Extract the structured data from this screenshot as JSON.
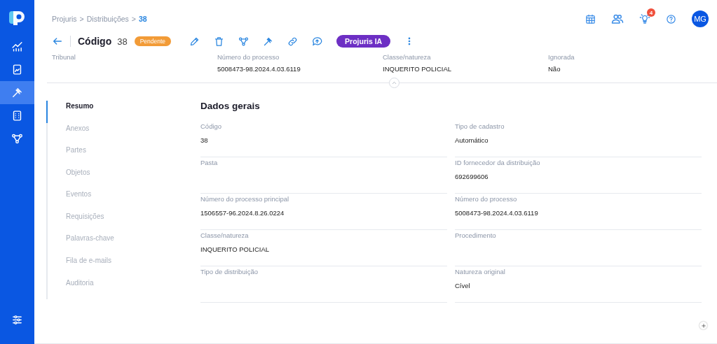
{
  "sidebar": {
    "items": [
      {
        "kind": "chart",
        "selected": false
      },
      {
        "kind": "document",
        "selected": false
      },
      {
        "kind": "gavel",
        "selected": true
      },
      {
        "kind": "calculator",
        "selected": false
      },
      {
        "kind": "workflow",
        "selected": false
      }
    ]
  },
  "breadcrumb": {
    "separator": ">",
    "items": [
      "Projuris",
      "Distribuições",
      "38"
    ]
  },
  "top_actions": {
    "notification_count": "4",
    "avatar": "MG"
  },
  "header": {
    "title": "Código",
    "code": "38",
    "status": "Pendente",
    "toolbar": [
      {
        "kind": "edit"
      },
      {
        "kind": "delete"
      },
      {
        "kind": "workflow"
      },
      {
        "kind": "gavel"
      },
      {
        "kind": "link"
      },
      {
        "kind": "comment"
      }
    ],
    "ai_button": "Projuris IA"
  },
  "summary": [
    {
      "label": "Tribunal"
    },
    {
      "label": "Número do processo",
      "value": "5008473-98.2024.4.03.6119"
    },
    {
      "label": "Classe/natureza",
      "value": "INQUERITO POLICIAL"
    },
    {
      "label": "Ignorada",
      "value": "Não"
    }
  ],
  "sections": [
    {
      "label": "Resumo",
      "selected": true
    },
    {
      "label": "Anexos",
      "selected": false
    },
    {
      "label": "Partes",
      "selected": false
    },
    {
      "label": "Objetos",
      "selected": false
    },
    {
      "label": "Eventos",
      "selected": false
    },
    {
      "label": "Requisições",
      "selected": false
    },
    {
      "label": "Palavras-chave",
      "selected": false
    },
    {
      "label": "Fila de e-mails",
      "selected": false
    },
    {
      "label": "Auditoria",
      "selected": false
    }
  ],
  "form": {
    "title": "Dados gerais",
    "fields": [
      {
        "label": "Código",
        "value": "38"
      },
      {
        "label": "Tipo de cadastro",
        "value": "Automático"
      },
      {
        "label": "Pasta"
      },
      {
        "label": "ID fornecedor da distribuição",
        "value": "692699606"
      },
      {
        "label": "Número do processo principal",
        "value": "1506557-96.2024.8.26.0224"
      },
      {
        "label": "Número do processo",
        "value": "5008473-98.2024.4.03.6119"
      },
      {
        "label": "Classe/natureza",
        "value": "INQUERITO POLICIAL"
      },
      {
        "label": "Procedimento"
      },
      {
        "label": "Tipo de distribuição"
      },
      {
        "label": "Natureza original",
        "value": "Cível"
      }
    ]
  }
}
